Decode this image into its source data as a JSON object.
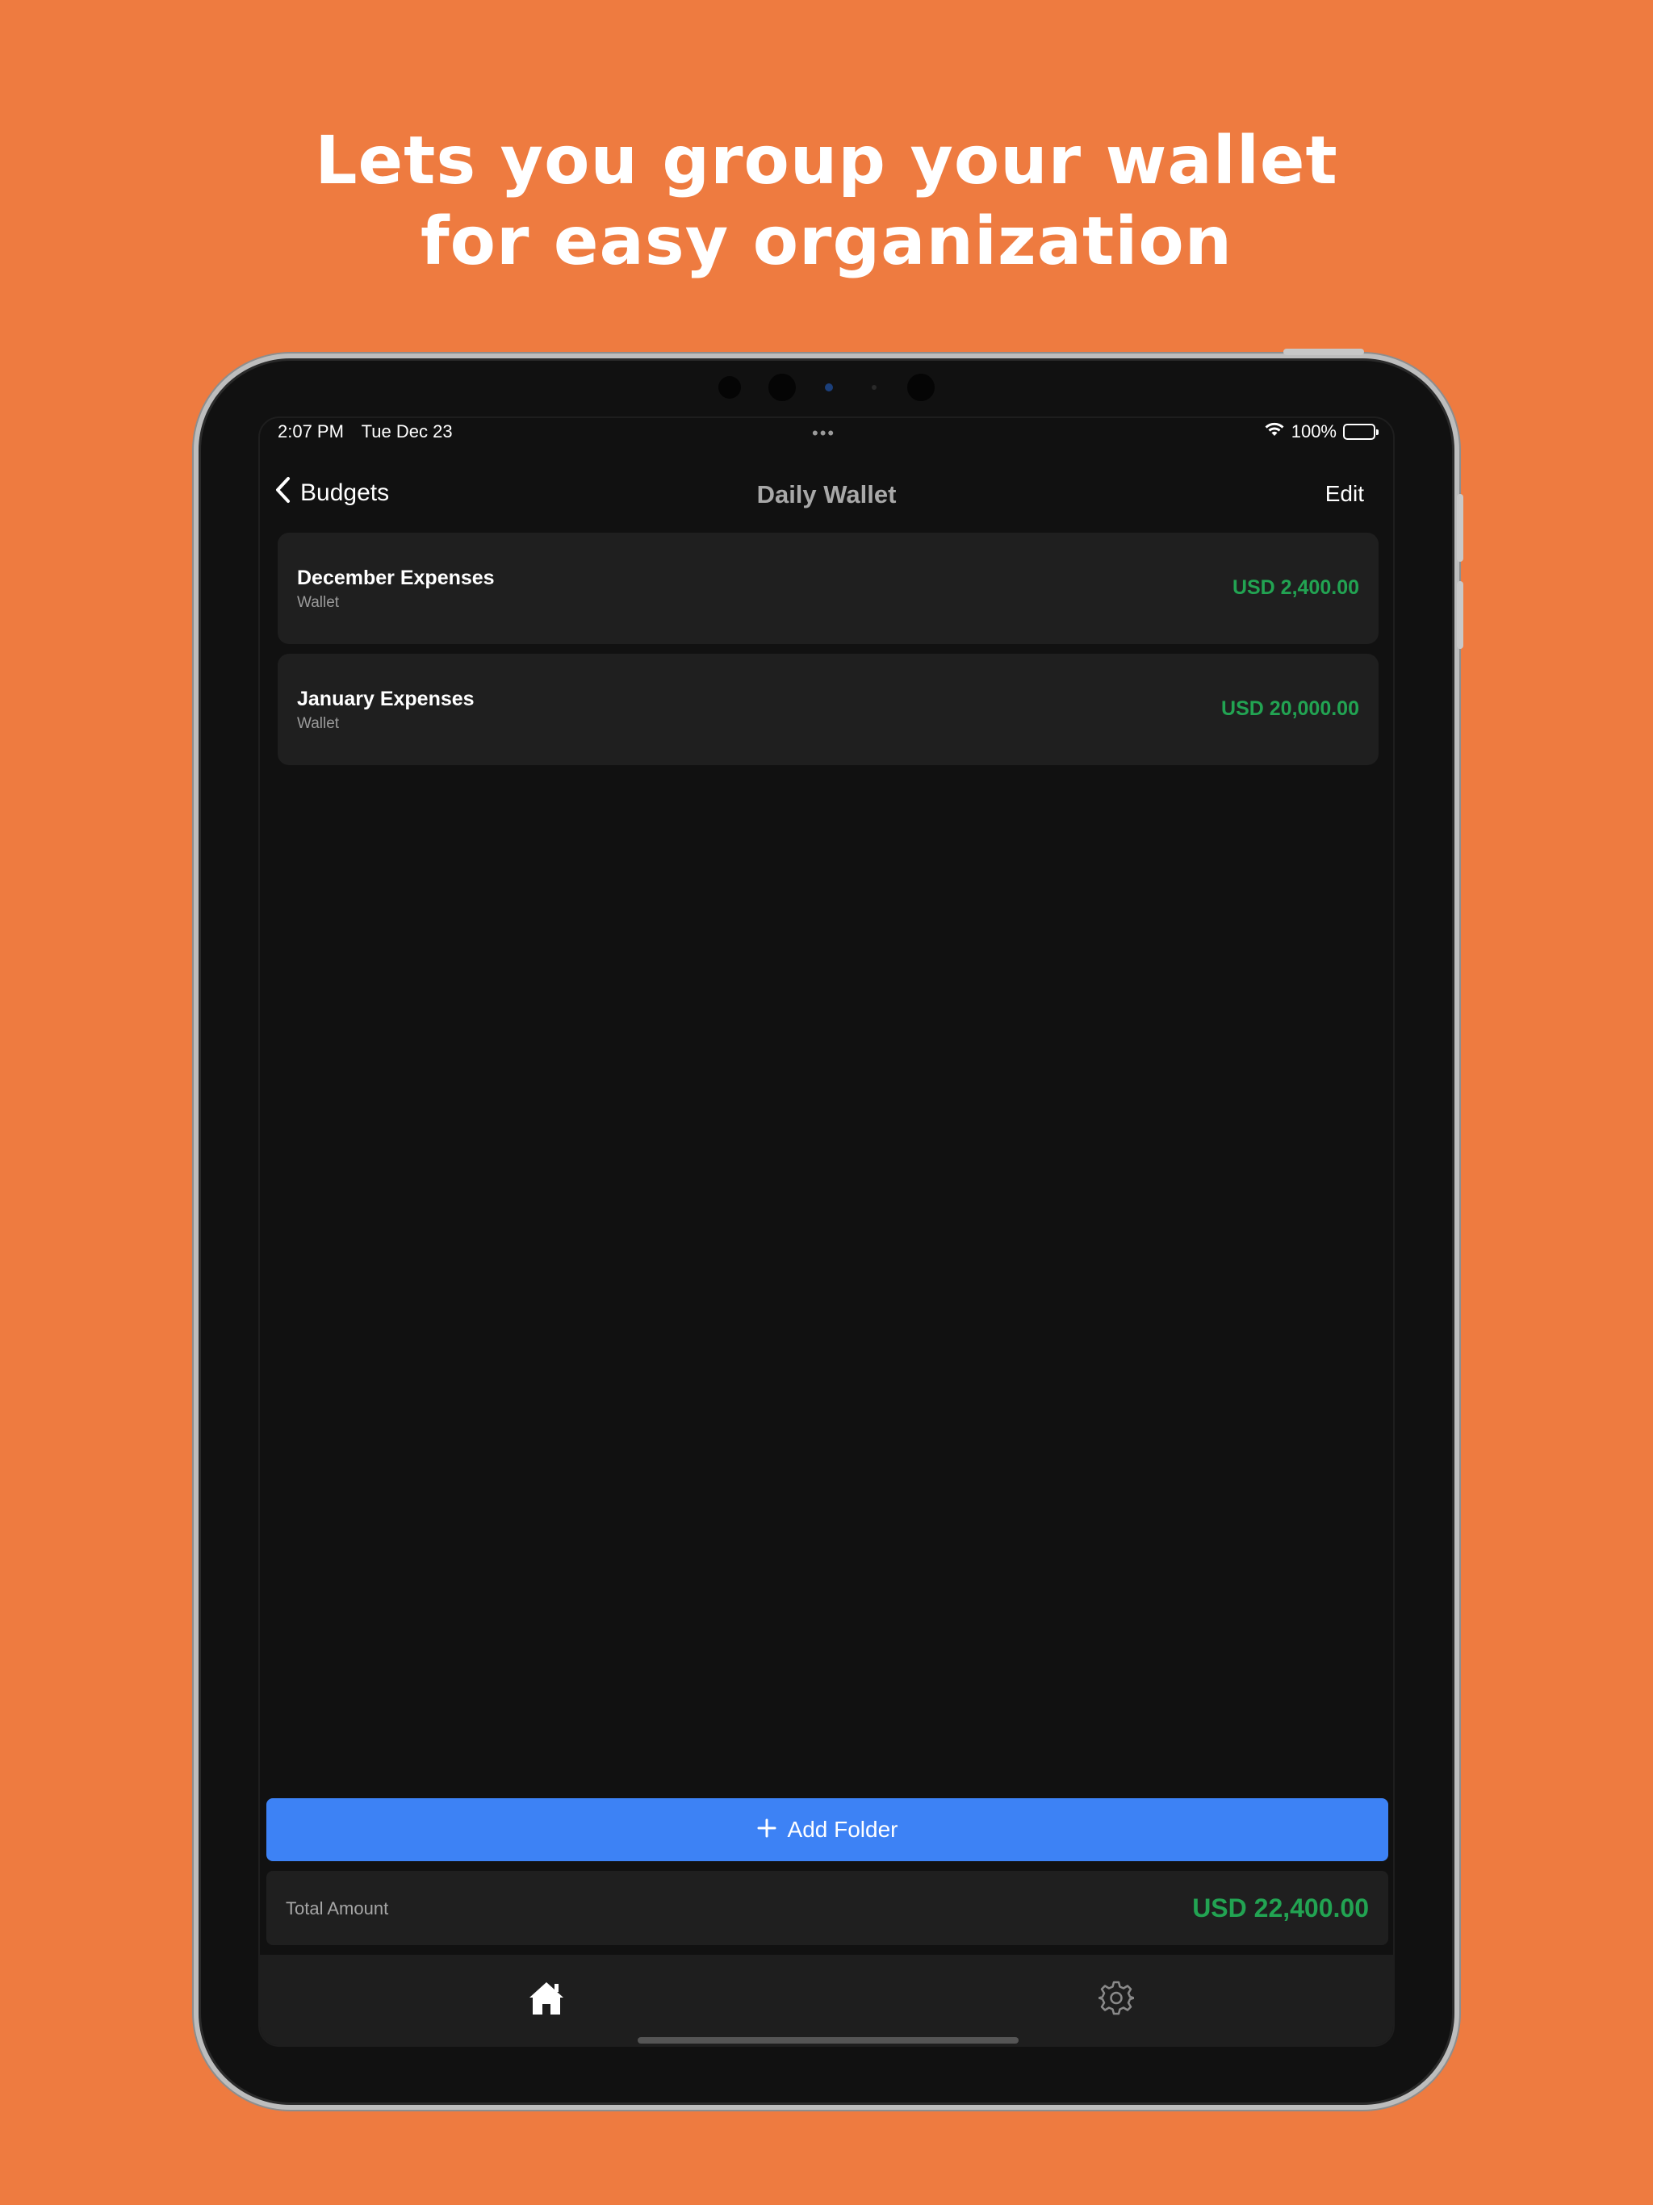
{
  "headline": {
    "line1": "Lets you group your wallet",
    "line2": "for easy organization"
  },
  "status_bar": {
    "time": "2:07 PM",
    "date": "Tue Dec 23",
    "dots": "•••",
    "battery": "100%"
  },
  "nav": {
    "back_label": "Budgets",
    "title": "Daily Wallet",
    "edit_label": "Edit"
  },
  "folders": [
    {
      "name": "December Expenses",
      "type": "Wallet",
      "amount": "USD 2,400.00"
    },
    {
      "name": "January Expenses",
      "type": "Wallet",
      "amount": "USD 20,000.00"
    }
  ],
  "add_folder_label": "Add Folder",
  "total": {
    "label": "Total Amount",
    "value": "USD 22,400.00"
  },
  "tabs": [
    {
      "icon": "home-icon",
      "active": true
    },
    {
      "icon": "gear-icon",
      "active": false
    }
  ],
  "colors": {
    "background": "#ee7b40",
    "accent_blue": "#3d82f5",
    "amount_green": "#22a352",
    "card": "#1f1f1f",
    "screen": "#111111"
  }
}
